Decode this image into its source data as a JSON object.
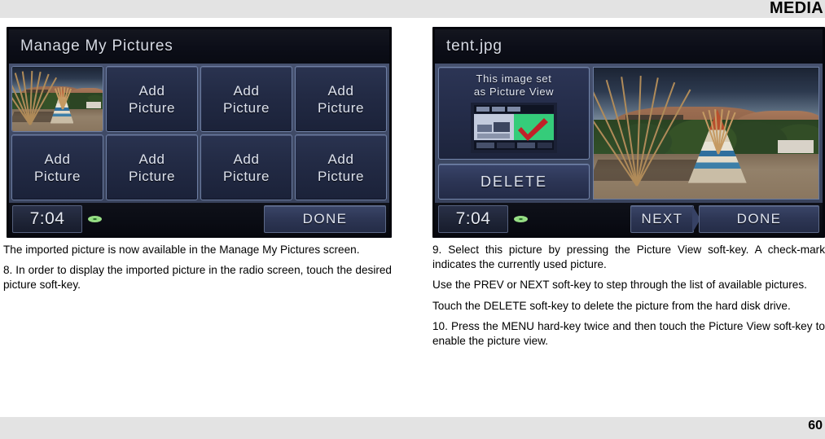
{
  "header": {
    "title": "MEDIA"
  },
  "footer": {
    "page_number": "60"
  },
  "left_screen": {
    "title": "Manage My Pictures",
    "tiles": [
      {
        "type": "photo",
        "label": ""
      },
      {
        "type": "add",
        "label": "Add\nPicture"
      },
      {
        "type": "add",
        "label": "Add\nPicture"
      },
      {
        "type": "add",
        "label": "Add\nPicture"
      },
      {
        "type": "add",
        "label": "Add\nPicture"
      },
      {
        "type": "add",
        "label": "Add\nPicture"
      },
      {
        "type": "add",
        "label": "Add\nPicture"
      },
      {
        "type": "add",
        "label": "Add\nPicture"
      }
    ],
    "tile_line1": "Add",
    "tile_line2": "Picture",
    "clock": "7:04",
    "disc_icon": "disc-icon",
    "done_label": "DONE"
  },
  "right_screen": {
    "title": "tent.jpg",
    "info_line1": "This image set",
    "info_line2": "as Picture View",
    "picture_view_icon": "picture-view-checkmark-icon",
    "delete_label": "DELETE",
    "clock": "7:04",
    "disc_icon": "disc-icon",
    "next_label": "NEXT",
    "done_label": "DONE"
  },
  "left_column": {
    "paragraphs": [
      "The imported picture is now available in the Manage My Pictures screen.",
      "8. In order to display the imported picture in the radio screen, touch the desired picture soft-key."
    ]
  },
  "right_column": {
    "paragraphs": [
      "9. Select this picture by pressing the Picture View soft-key. A check-mark indicates the currently used picture.",
      "Use the PREV or NEXT soft-key to step through the list of available pictures.",
      "Touch the DELETE soft-key to delete the picture from the hard disk drive.",
      "10. Press the MENU hard-key twice and then touch the Picture View soft-key to enable the picture view."
    ]
  },
  "colors": {
    "band": "#e3e3e3",
    "screen_bg": "#05060c",
    "panel_blue": "#3f4a66",
    "tile_blue": "#222a44",
    "check_green": "#35cc7a",
    "check_red": "#c02128"
  }
}
